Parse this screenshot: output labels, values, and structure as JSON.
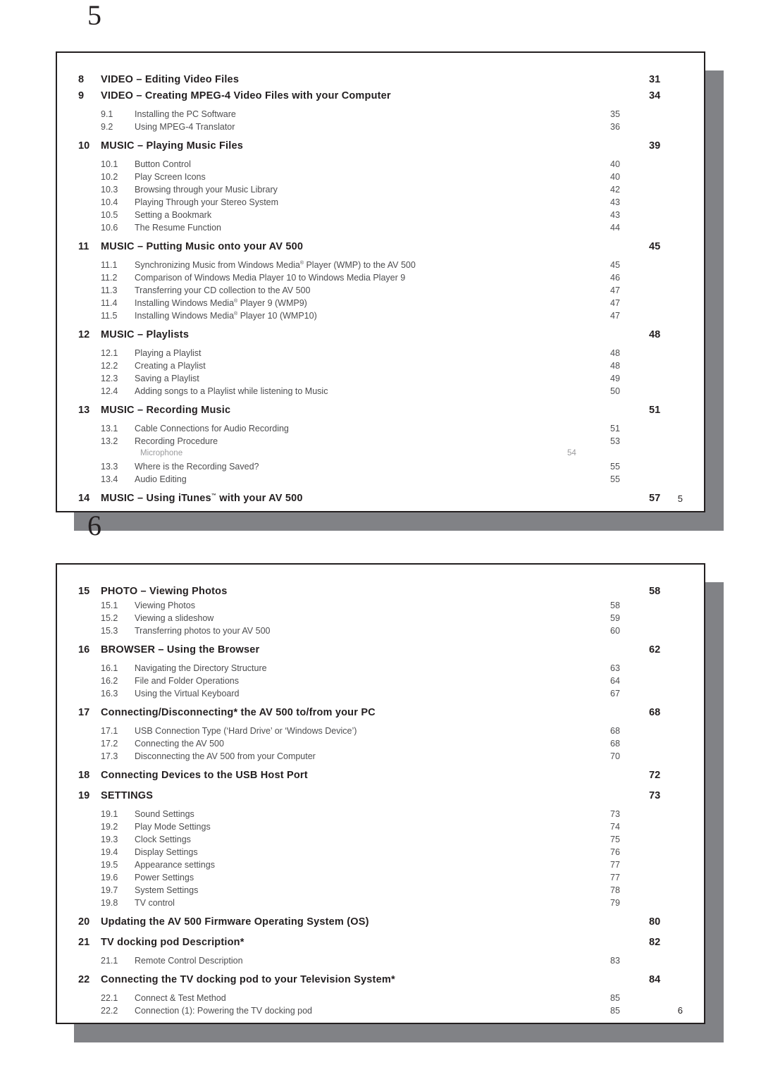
{
  "pages": [
    {
      "page_label": "5",
      "footer_page": "5",
      "entries": [
        {
          "type": "chapter",
          "num": "8",
          "title": "VIDEO – Editing Video Files",
          "page": "31"
        },
        {
          "type": "chapter",
          "num": "9",
          "title": "VIDEO – Creating MPEG-4 Video Files with your Computer",
          "page": "34"
        },
        {
          "type": "section",
          "num": "9.1",
          "title": "Installing the PC Software",
          "page": "35"
        },
        {
          "type": "section",
          "num": "9.2",
          "title": "Using MPEG-4 Translator",
          "page": "36"
        },
        {
          "type": "chapter",
          "num": "10",
          "title": "MUSIC – Playing Music Files",
          "page": "39"
        },
        {
          "type": "section",
          "num": "10.1",
          "title": "Button Control",
          "page": "40"
        },
        {
          "type": "section",
          "num": "10.2",
          "title": "Play Screen Icons",
          "page": "40"
        },
        {
          "type": "section",
          "num": "10.3",
          "title": "Browsing through your Music Library",
          "page": "42"
        },
        {
          "type": "section",
          "num": "10.4",
          "title": "Playing Through your Stereo System",
          "page": "43"
        },
        {
          "type": "section",
          "num": "10.5",
          "title": "Setting a Bookmark",
          "page": "43"
        },
        {
          "type": "section",
          "num": "10.6",
          "title": "The Resume Function",
          "page": "44"
        },
        {
          "type": "chapter",
          "num": "11",
          "title": "MUSIC – Putting Music onto your AV 500",
          "page": "45"
        },
        {
          "type": "section",
          "num": "11.1",
          "title": "Synchronizing Music from Windows Media® Player (WMP) to the AV 500",
          "page": "45"
        },
        {
          "type": "section",
          "num": "11.2",
          "title": "Comparison of Windows Media Player 10 to Windows Media Player 9",
          "page": "46"
        },
        {
          "type": "section",
          "num": "11.3",
          "title": "Transferring your CD collection to the AV 500",
          "page": "47"
        },
        {
          "type": "section",
          "num": "11.4",
          "title": "Installing Windows Media® Player 9 (WMP9)",
          "page": "47"
        },
        {
          "type": "section",
          "num": "11.5",
          "title": "Installing Windows Media® Player 10 (WMP10)",
          "page": "47"
        },
        {
          "type": "chapter",
          "num": "12",
          "title": "MUSIC – Playlists",
          "page": "48"
        },
        {
          "type": "section",
          "num": "12.1",
          "title": "Playing a Playlist",
          "page": "48"
        },
        {
          "type": "section",
          "num": "12.2",
          "title": "Creating a Playlist",
          "page": "48"
        },
        {
          "type": "section",
          "num": "12.3",
          "title": "Saving a Playlist",
          "page": "49"
        },
        {
          "type": "section",
          "num": "12.4",
          "title": "Adding songs to a Playlist while listening to Music",
          "page": "50"
        },
        {
          "type": "chapter",
          "num": "13",
          "title": "MUSIC – Recording Music",
          "page": "51"
        },
        {
          "type": "section",
          "num": "13.1",
          "title": "Cable Connections for Audio Recording",
          "page": "51"
        },
        {
          "type": "section",
          "num": "13.2",
          "title": "Recording Procedure",
          "page": "53"
        },
        {
          "type": "minor",
          "num": "",
          "title": "Microphone",
          "page": "54"
        },
        {
          "type": "section",
          "num": "13.3",
          "title": "Where is the Recording Saved?",
          "page": "55"
        },
        {
          "type": "section",
          "num": "13.4",
          "title": "Audio Editing",
          "page": "55"
        },
        {
          "type": "chapter",
          "num": "14",
          "title": "MUSIC – Using iTunes™ with your AV 500",
          "page": "57"
        }
      ]
    },
    {
      "page_label": "6",
      "footer_page": "6",
      "entries": [
        {
          "type": "chapter",
          "num": "15",
          "title": "PHOTO – Viewing Photos",
          "page": "58"
        },
        {
          "type": "section",
          "num": "15.1",
          "title": "Viewing Photos",
          "page": "58"
        },
        {
          "type": "section",
          "num": "15.2",
          "title": "Viewing a slideshow",
          "page": "59"
        },
        {
          "type": "section",
          "num": "15.3",
          "title": "Transferring photos to your AV 500",
          "page": "60"
        },
        {
          "type": "chapter",
          "num": "16",
          "title": "BROWSER – Using the Browser",
          "page": "62"
        },
        {
          "type": "section",
          "num": "16.1",
          "title": "Navigating the Directory Structure",
          "page": "63"
        },
        {
          "type": "section",
          "num": "16.2",
          "title": "File and Folder Operations",
          "page": "64"
        },
        {
          "type": "section",
          "num": "16.3",
          "title": "Using the Virtual Keyboard",
          "page": "67"
        },
        {
          "type": "chapter",
          "num": "17",
          "title": "Connecting/Disconnecting* the AV 500 to/from your PC",
          "page": "68"
        },
        {
          "type": "section",
          "num": "17.1",
          "title": "USB Connection Type (‘Hard Drive’ or ‘Windows Device’)",
          "page": "68"
        },
        {
          "type": "section",
          "num": "17.2",
          "title": "Connecting the AV 500",
          "page": "68"
        },
        {
          "type": "section",
          "num": "17.3",
          "title": "Disconnecting the AV 500 from your Computer",
          "page": "70"
        },
        {
          "type": "chapter",
          "num": "18",
          "title": "Connecting Devices to the USB Host Port",
          "page": "72"
        },
        {
          "type": "chapter",
          "num": "19",
          "title": "SETTINGS",
          "page": "73"
        },
        {
          "type": "section",
          "num": "19.1",
          "title": "Sound Settings",
          "page": "73"
        },
        {
          "type": "section",
          "num": "19.2",
          "title": "Play Mode Settings",
          "page": "74"
        },
        {
          "type": "section",
          "num": "19.3",
          "title": "Clock Settings",
          "page": "75"
        },
        {
          "type": "section",
          "num": "19.4",
          "title": "Display Settings",
          "page": "76"
        },
        {
          "type": "section",
          "num": "19.5",
          "title": "Appearance settings",
          "page": "77"
        },
        {
          "type": "section",
          "num": "19.6",
          "title": "Power Settings",
          "page": "77"
        },
        {
          "type": "section",
          "num": "19.7",
          "title": "System Settings",
          "page": "78"
        },
        {
          "type": "section",
          "num": "19.8",
          "title": "TV control",
          "page": "79"
        },
        {
          "type": "chapter",
          "num": "20",
          "title": "Updating the AV 500 Firmware Operating System (OS)",
          "page": "80"
        },
        {
          "type": "chapter",
          "num": "21",
          "title": "TV docking pod Description*",
          "page": "82"
        },
        {
          "type": "section",
          "num": "21.1",
          "title": "Remote Control Description",
          "page": "83"
        },
        {
          "type": "chapter",
          "num": "22",
          "title": "Connecting the TV docking pod to your Television System*",
          "page": "84"
        },
        {
          "type": "section",
          "num": "22.1",
          "title": "Connect & Test Method",
          "page": "85"
        },
        {
          "type": "section",
          "num": "22.2",
          "title": "Connection (1): Powering the TV docking pod",
          "page": "85"
        }
      ]
    }
  ]
}
